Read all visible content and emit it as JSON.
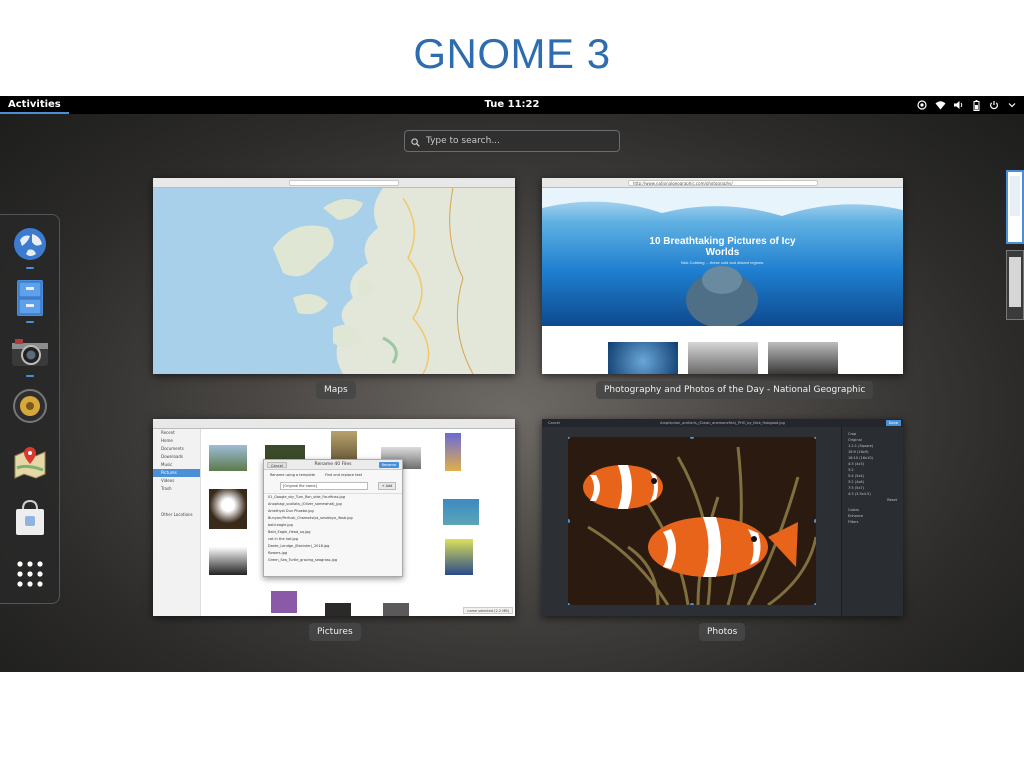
{
  "slide": {
    "title": "GNOME 3"
  },
  "topbar": {
    "activities": "Activities",
    "clock": "Tue 11:22"
  },
  "search": {
    "placeholder": "Type to search..."
  },
  "dash": {
    "items": [
      {
        "icon": "web-browser-icon"
      },
      {
        "icon": "file-cabinet-icon"
      },
      {
        "icon": "camera-icon"
      },
      {
        "icon": "speaker-icon"
      },
      {
        "icon": "maps-icon"
      },
      {
        "icon": "software-bag-icon"
      },
      {
        "icon": "app-grid-icon"
      }
    ]
  },
  "windows": [
    {
      "label": "Maps"
    },
    {
      "label": "Photography and Photos of the Day - National Geographic",
      "url": "http://www.nationalgeographic.com/photography/",
      "headline": "10 Breathtaking Pictures of Icy Worlds",
      "sub": "Nick Cobbing ... these cold and distant regions."
    },
    {
      "label": "Pictures",
      "sidebar": [
        "Recent",
        "Home",
        "Documents",
        "Downloads",
        "Music",
        "Pictures",
        "Videos",
        "Trash",
        "Other Locations"
      ],
      "dialog": {
        "title": "Rename 40 Files",
        "cancel": "Cancel",
        "rename": "Rename",
        "option1": "Rename using a template",
        "option2": "Find and replace text",
        "template": "[Original file name]",
        "add": "+ Add",
        "files": [
          "01_Google_sky_Turn_Ron_side_Fourfinas.jpg",
          "Anophagi_scollata_(Oliver_somewhat)_jpg",
          "Amethyst Dun Phoebe.jpg",
          "Bunyan/Perfusk_Chamolisiya_smokbyo_ifasb.jpg",
          "bald.eagle.jpg",
          "Bald_Eagle_Head_sq.jpg",
          "cat in the hat.jpg",
          "Dante_Lendge_(Banister)_2018.jpg",
          "flowers.jpg",
          "Green_Sea_Turtle_grazing_seagrass.jpg"
        ]
      },
      "status": "name selected (2.2 MB)"
    },
    {
      "label": "Photos",
      "title": "Amphiprion_ocellaris_(Clown_anemonefish)_PHO_by_Nick_Hobgood.jpg",
      "done": "Done",
      "back": "Cancel",
      "sidebar": [
        "Crop",
        "Original",
        "1.2:1 (Square)",
        "16:9 (16x9)",
        "16:10 (16x10)",
        "4:3 (4x3)",
        "3:2",
        "5:4 (5x4)",
        "3:2 (4x6)",
        "7:5 (5x7)",
        "4:3 (3.5x4.5)",
        "Reset",
        "Colors",
        "Enhance",
        "Filters"
      ]
    }
  ],
  "colors": {
    "accent": "#4a90d9",
    "title": "#2d6cae"
  }
}
